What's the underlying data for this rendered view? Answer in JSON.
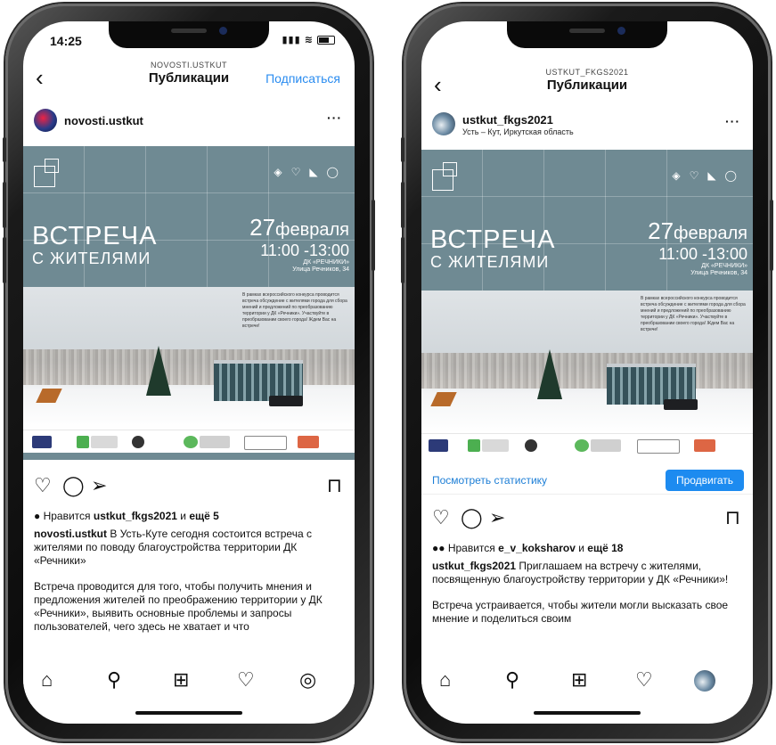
{
  "left": {
    "status": {
      "time": "14:25"
    },
    "nav": {
      "subtitle": "NOVOSTI.USTKUT",
      "title": "Публикации",
      "subscribe": "Подписаться"
    },
    "post": {
      "username": "novosti.ustkut",
      "more": "···"
    },
    "banner": {
      "headline": "ВСТРЕЧА",
      "subheadline": "С ЖИТЕЛЯМИ",
      "day": "27",
      "month": "февраля",
      "time": "11:00 -13:00",
      "venue": "ДК «РЕЧНИКИ»",
      "address": "Улица Речников, 34",
      "body_text": "В рамках всероссийского конкурса проводится встреча обсуждение с жителями города для сбора мнений и предложений по преобразованию территории у ДК «Речники». Участвуйте в преобразовании своего города! Ждем Вас на встрече!"
    },
    "likes": {
      "prefix": "Нравится",
      "user": "ustkut_fkgs2021",
      "middle": "и",
      "more": "ещё 5"
    },
    "caption": {
      "author": "novosti.ustkut",
      "text": "В Усть-Куте сегодня состоится встреча с жителями по поводу благоустройства территории ДК «Речники»",
      "paragraph2": "Встреча проводится для того, чтобы получить мнения и предложения жителей по преображению территории у ДК «Речники», выявить основные проблемы и запросы пользователей, чего здесь не хватает и что"
    },
    "icons": [
      "heart-icon",
      "comment-icon",
      "share-icon",
      "bookmark-icon"
    ],
    "tabs": [
      "home-icon",
      "search-icon",
      "new-post-icon",
      "activity-icon",
      "profile-icon"
    ]
  },
  "right": {
    "nav": {
      "subtitle": "USTKUT_FKGS2021",
      "title": "Публикации"
    },
    "post": {
      "username": "ustkut_fkgs2021",
      "location": "Усть – Кут, Иркутская область",
      "more": "···"
    },
    "banner": {
      "headline": "ВСТРЕЧА",
      "subheadline": "С ЖИТЕЛЯМИ",
      "day": "27",
      "month": "февраля",
      "time": "11:00 -13:00",
      "venue": "ДК «РЕЧНИКИ»",
      "address": "Улица Речников, 34",
      "body_text": "В рамках всероссийского конкурса проводится встреча обсуждение с жителями города для сбора мнений и предложений по преобразованию территории у ДК «Речники». Участвуйте в преобразовании своего города! Ждем Вас на встрече!"
    },
    "stats": {
      "link": "Посмотреть статистику",
      "promote": "Продвигать"
    },
    "likes": {
      "prefix": "Нравится",
      "user": "e_v_koksharov",
      "middle": "и",
      "more": "ещё 18"
    },
    "caption": {
      "author": "ustkut_fkgs2021",
      "text": "Приглашаем на встречу с жителями, посвященную благоустройству территории у ДК «Речники»!",
      "paragraph2": "Встреча устраивается, чтобы жители могли высказать свое мнение и поделиться своим"
    }
  },
  "colors": {
    "banner": "#6f8a93",
    "link": "#2a8cf0",
    "promote": "#1d8bf0"
  }
}
